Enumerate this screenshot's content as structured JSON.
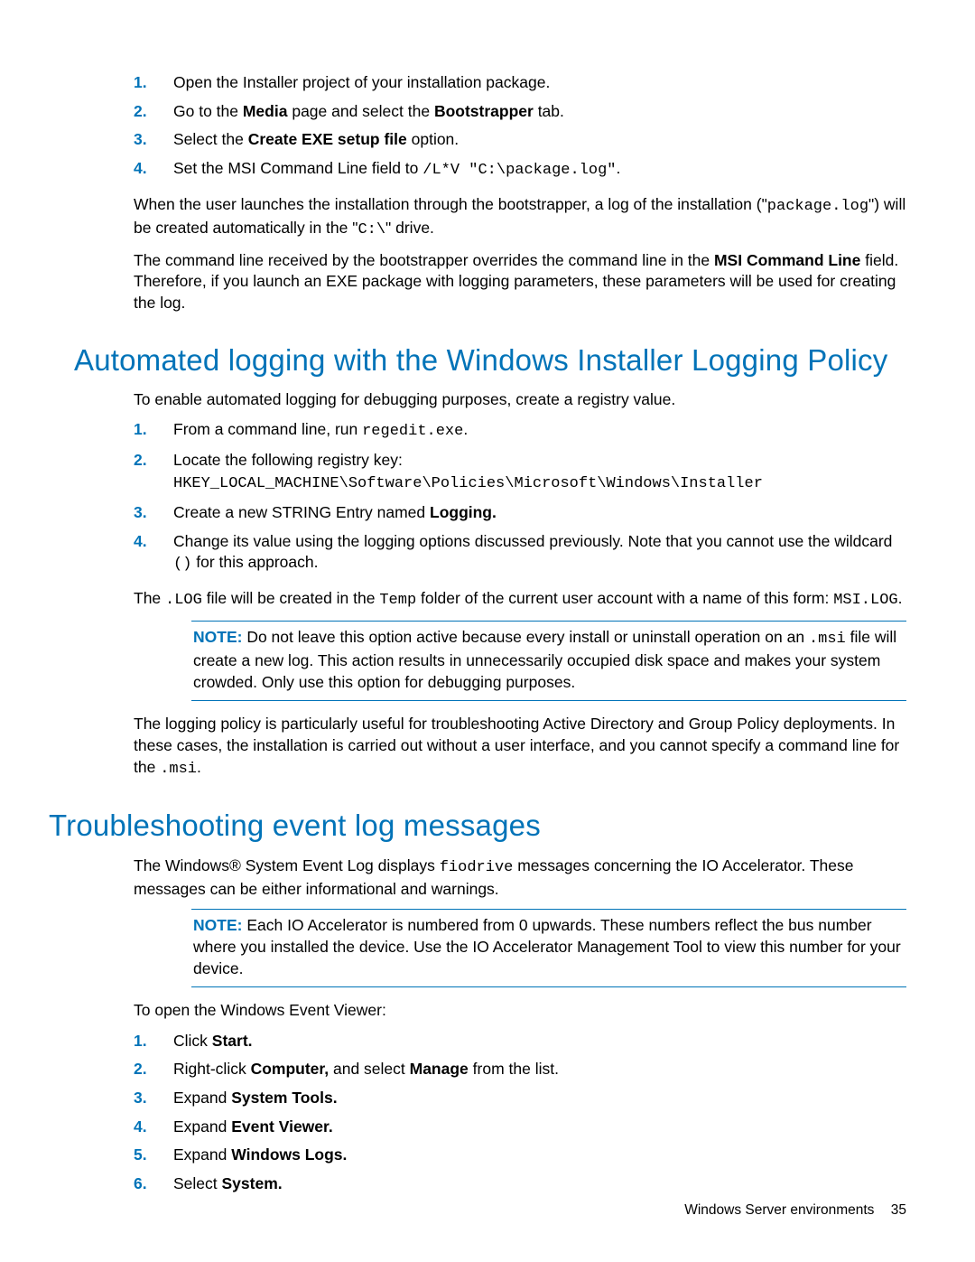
{
  "list1": {
    "items": [
      {
        "num": "1.",
        "parts": [
          {
            "t": "text",
            "v": "Open the Installer project of your installation package."
          }
        ]
      },
      {
        "num": "2.",
        "parts": [
          {
            "t": "text",
            "v": "Go to the "
          },
          {
            "t": "b",
            "v": "Media"
          },
          {
            "t": "text",
            "v": " page and select the "
          },
          {
            "t": "b",
            "v": "Bootstrapper"
          },
          {
            "t": "text",
            "v": " tab."
          }
        ]
      },
      {
        "num": "3.",
        "parts": [
          {
            "t": "text",
            "v": "Select the "
          },
          {
            "t": "b",
            "v": "Create EXE setup file"
          },
          {
            "t": "text",
            "v": " option."
          }
        ]
      },
      {
        "num": "4.",
        "parts": [
          {
            "t": "text",
            "v": "Set the MSI Command Line field to "
          },
          {
            "t": "code",
            "v": "/L*V \"C:\\package.log\""
          },
          {
            "t": "text",
            "v": "."
          }
        ]
      }
    ]
  },
  "para1": [
    {
      "t": "text",
      "v": "When the user launches the installation through the bootstrapper, a log of the installation (\""
    },
    {
      "t": "code",
      "v": "package.log"
    },
    {
      "t": "text",
      "v": "\") will be created automatically in the \""
    },
    {
      "t": "code",
      "v": "C:\\"
    },
    {
      "t": "text",
      "v": "\" drive."
    }
  ],
  "para2": [
    {
      "t": "text",
      "v": "The command line received by the bootstrapper overrides the command line in the "
    },
    {
      "t": "b",
      "v": "MSI Command Line"
    },
    {
      "t": "text",
      "v": " field. Therefore, if you launch an EXE package with logging parameters, these parameters will be used for creating the log."
    }
  ],
  "h2a": "Automated logging with the Windows Installer Logging Policy",
  "para3": [
    {
      "t": "text",
      "v": "To enable automated logging for debugging purposes, create a registry value."
    }
  ],
  "list2": {
    "items": [
      {
        "num": "1.",
        "parts": [
          {
            "t": "text",
            "v": "From a command line, run "
          },
          {
            "t": "code",
            "v": "regedit.exe"
          },
          {
            "t": "text",
            "v": "."
          }
        ]
      },
      {
        "num": "2.",
        "parts": [
          {
            "t": "text",
            "v": "Locate the following registry key:"
          },
          {
            "t": "br"
          },
          {
            "t": "code",
            "v": "HKEY_LOCAL_MACHINE\\Software\\Policies\\Microsoft\\Windows\\Installer"
          }
        ]
      },
      {
        "num": "3.",
        "parts": [
          {
            "t": "text",
            "v": "Create a new STRING Entry named "
          },
          {
            "t": "b",
            "v": "Logging."
          }
        ]
      },
      {
        "num": "4.",
        "parts": [
          {
            "t": "text",
            "v": "Change its value using the logging options discussed previously. Note that you cannot use the wildcard "
          },
          {
            "t": "code",
            "v": "()"
          },
          {
            "t": "text",
            "v": " for this approach."
          }
        ]
      }
    ]
  },
  "para4": [
    {
      "t": "text",
      "v": "The "
    },
    {
      "t": "code",
      "v": ".LOG"
    },
    {
      "t": "text",
      "v": " file will be created in the "
    },
    {
      "t": "code",
      "v": "Temp"
    },
    {
      "t": "text",
      "v": " folder of the current user account with a name of this form: "
    },
    {
      "t": "code",
      "v": "MSI.LOG"
    },
    {
      "t": "text",
      "v": "."
    }
  ],
  "note1": {
    "label": "NOTE:",
    "parts": [
      {
        "t": "text",
        "v": "Do not leave this option active because every install or uninstall operation on an "
      },
      {
        "t": "code",
        "v": ".msi"
      },
      {
        "t": "text",
        "v": " file will create a new log. This action results in unnecessarily occupied disk space and makes your system crowded. Only use this option for debugging purposes."
      }
    ]
  },
  "para5": [
    {
      "t": "text",
      "v": "The logging policy is particularly useful for troubleshooting Active Directory and Group Policy deployments. In these cases, the installation is carried out without a user interface, and you cannot specify a command line for the "
    },
    {
      "t": "code",
      "v": ".msi"
    },
    {
      "t": "text",
      "v": "."
    }
  ],
  "h2b": "Troubleshooting event log messages",
  "para6": [
    {
      "t": "text",
      "v": "The Windows® System Event Log displays "
    },
    {
      "t": "code",
      "v": "fiodrive"
    },
    {
      "t": "text",
      "v": " messages concerning the IO Accelerator. These messages can be either informational and warnings."
    }
  ],
  "note2": {
    "label": "NOTE:",
    "parts": [
      {
        "t": "text",
        "v": "Each IO Accelerator is numbered from 0 upwards. These numbers reflect the bus number where you installed the device. Use the IO Accelerator Management Tool to view this number for your device."
      }
    ]
  },
  "para7": [
    {
      "t": "text",
      "v": "To open the Windows Event Viewer:"
    }
  ],
  "list3": {
    "items": [
      {
        "num": "1.",
        "parts": [
          {
            "t": "text",
            "v": "Click "
          },
          {
            "t": "b",
            "v": "Start."
          }
        ]
      },
      {
        "num": "2.",
        "parts": [
          {
            "t": "text",
            "v": "Right-click "
          },
          {
            "t": "b",
            "v": "Computer,"
          },
          {
            "t": "text",
            "v": " and select "
          },
          {
            "t": "b",
            "v": "Manage"
          },
          {
            "t": "text",
            "v": " from the list."
          }
        ]
      },
      {
        "num": "3.",
        "parts": [
          {
            "t": "text",
            "v": "Expand "
          },
          {
            "t": "b",
            "v": "System Tools."
          }
        ]
      },
      {
        "num": "4.",
        "parts": [
          {
            "t": "text",
            "v": "Expand "
          },
          {
            "t": "b",
            "v": "Event Viewer."
          }
        ]
      },
      {
        "num": "5.",
        "parts": [
          {
            "t": "text",
            "v": "Expand "
          },
          {
            "t": "b",
            "v": "Windows Logs."
          }
        ]
      },
      {
        "num": "6.",
        "parts": [
          {
            "t": "text",
            "v": "Select "
          },
          {
            "t": "b",
            "v": "System."
          }
        ]
      }
    ]
  },
  "footer": {
    "text": "Windows Server environments",
    "page": "35"
  }
}
